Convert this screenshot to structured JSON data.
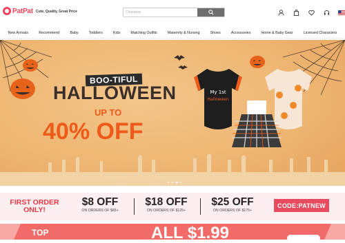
{
  "brand": {
    "name": "PatPat",
    "tagline": "Cute, Quality, Great Price",
    "color": "#f1435a"
  },
  "search": {
    "placeholder": "Christmas"
  },
  "header_icons": [
    "user-icon",
    "bag-icon",
    "heart-icon",
    "headset-icon",
    "us-flag-icon"
  ],
  "nav": {
    "items": [
      "New Arrivals",
      "Recommend",
      "Baby",
      "Toddlers",
      "Kids",
      "Matching Outfits",
      "Maternity & Nursing",
      "Shoes",
      "Accessories",
      "Home & Baby Gear",
      "Licensed Characters"
    ]
  },
  "banner": {
    "headline_small": "BOO-TIFUL",
    "headline_large": "HALLOWEEN",
    "up_to": "UP TO",
    "discount": "40% OFF",
    "carousel": {
      "total": 4,
      "active": 1
    }
  },
  "promo": {
    "first_order": "FIRST ORDER ONLY!",
    "deals": [
      {
        "amount": "$8 OFF",
        "condition": "ON ORDERS OF $65+"
      },
      {
        "amount": "$18 OFF",
        "condition": "ON ORDERS OF $125+"
      },
      {
        "amount": "$25 OFF",
        "condition": "ON ORDERS OF $175+"
      }
    ],
    "code": "CODE:PATNEW",
    "accent": "#e94b5f"
  },
  "bottom": {
    "top_label": "TOP",
    "price_text": "ALL $1.99"
  }
}
